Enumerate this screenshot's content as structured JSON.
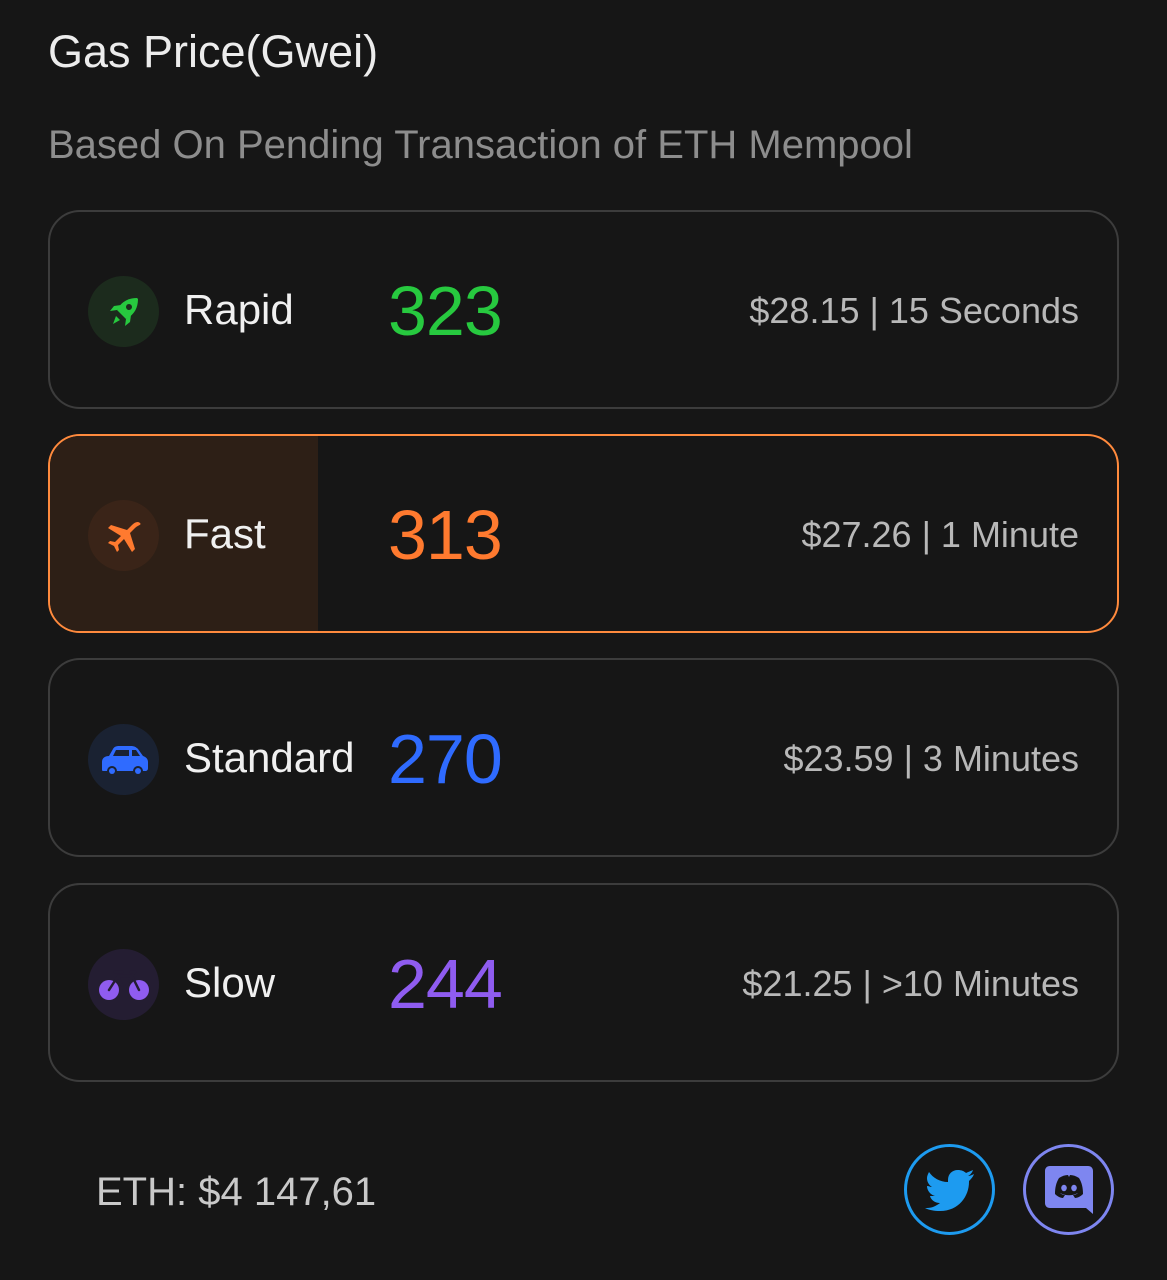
{
  "header": {
    "title": "Gas Price(Gwei)",
    "subtitle": "Based On Pending Transaction of ETH Mempool"
  },
  "tiers": [
    {
      "label": "Rapid",
      "gwei": "323",
      "meta": "$28.15 | 15 Seconds",
      "color": "#27c93f",
      "icon_bg": "#1c2b1d",
      "icon": "rocket-icon",
      "selected": false
    },
    {
      "label": "Fast",
      "gwei": "313",
      "meta": "$27.26 | 1 Minute",
      "color": "#ff7a2f",
      "icon_bg": "#3a2418",
      "icon": "airplane-icon",
      "selected": true
    },
    {
      "label": "Standard",
      "gwei": "270",
      "meta": "$23.59 | 3 Minutes",
      "color": "#2f6bff",
      "icon_bg": "#1a2232",
      "icon": "car-icon",
      "selected": false
    },
    {
      "label": "Slow",
      "gwei": "244",
      "meta": "$21.25 | >10 Minutes",
      "color": "#8f5cf0",
      "icon_bg": "#241d32",
      "icon": "bicycle-icon",
      "selected": false
    }
  ],
  "footer": {
    "eth_price": "ETH: $4 147,61",
    "twitter_icon": "twitter-icon",
    "discord_icon": "discord-icon",
    "twitter_color": "#1d9bf0",
    "discord_color": "#7e86f0"
  }
}
